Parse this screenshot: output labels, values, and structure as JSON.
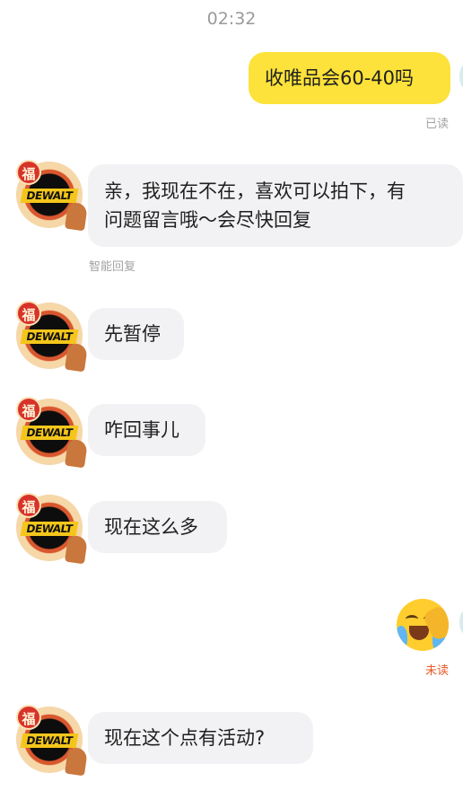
{
  "header": {
    "time": "02:32"
  },
  "messages": [
    {
      "direction": "out",
      "text": "收唯品会60-40吗",
      "status": "已读"
    },
    {
      "direction": "in",
      "lines": [
        "亲，我现在不在，喜欢可以拍下，有",
        "问题留言哦～会尽快回复"
      ],
      "caption": "智能回复"
    },
    {
      "direction": "in",
      "text": "先暂停"
    },
    {
      "direction": "in",
      "text": "咋回事儿"
    },
    {
      "direction": "in",
      "text": "现在这么多"
    },
    {
      "direction": "out",
      "emoji": "crying-laughing-emoji",
      "status": "未读"
    },
    {
      "direction": "in",
      "text": "现在这个点有活动?"
    }
  ],
  "avatar": {
    "icon": "dewalt-shop-avatar-icon",
    "badge_char": "福",
    "brand_text": "DEWALT"
  },
  "colors": {
    "out_bubble": "#fce23a",
    "in_bubble": "#f2f2f4",
    "unread_status": "#ea5a25"
  }
}
